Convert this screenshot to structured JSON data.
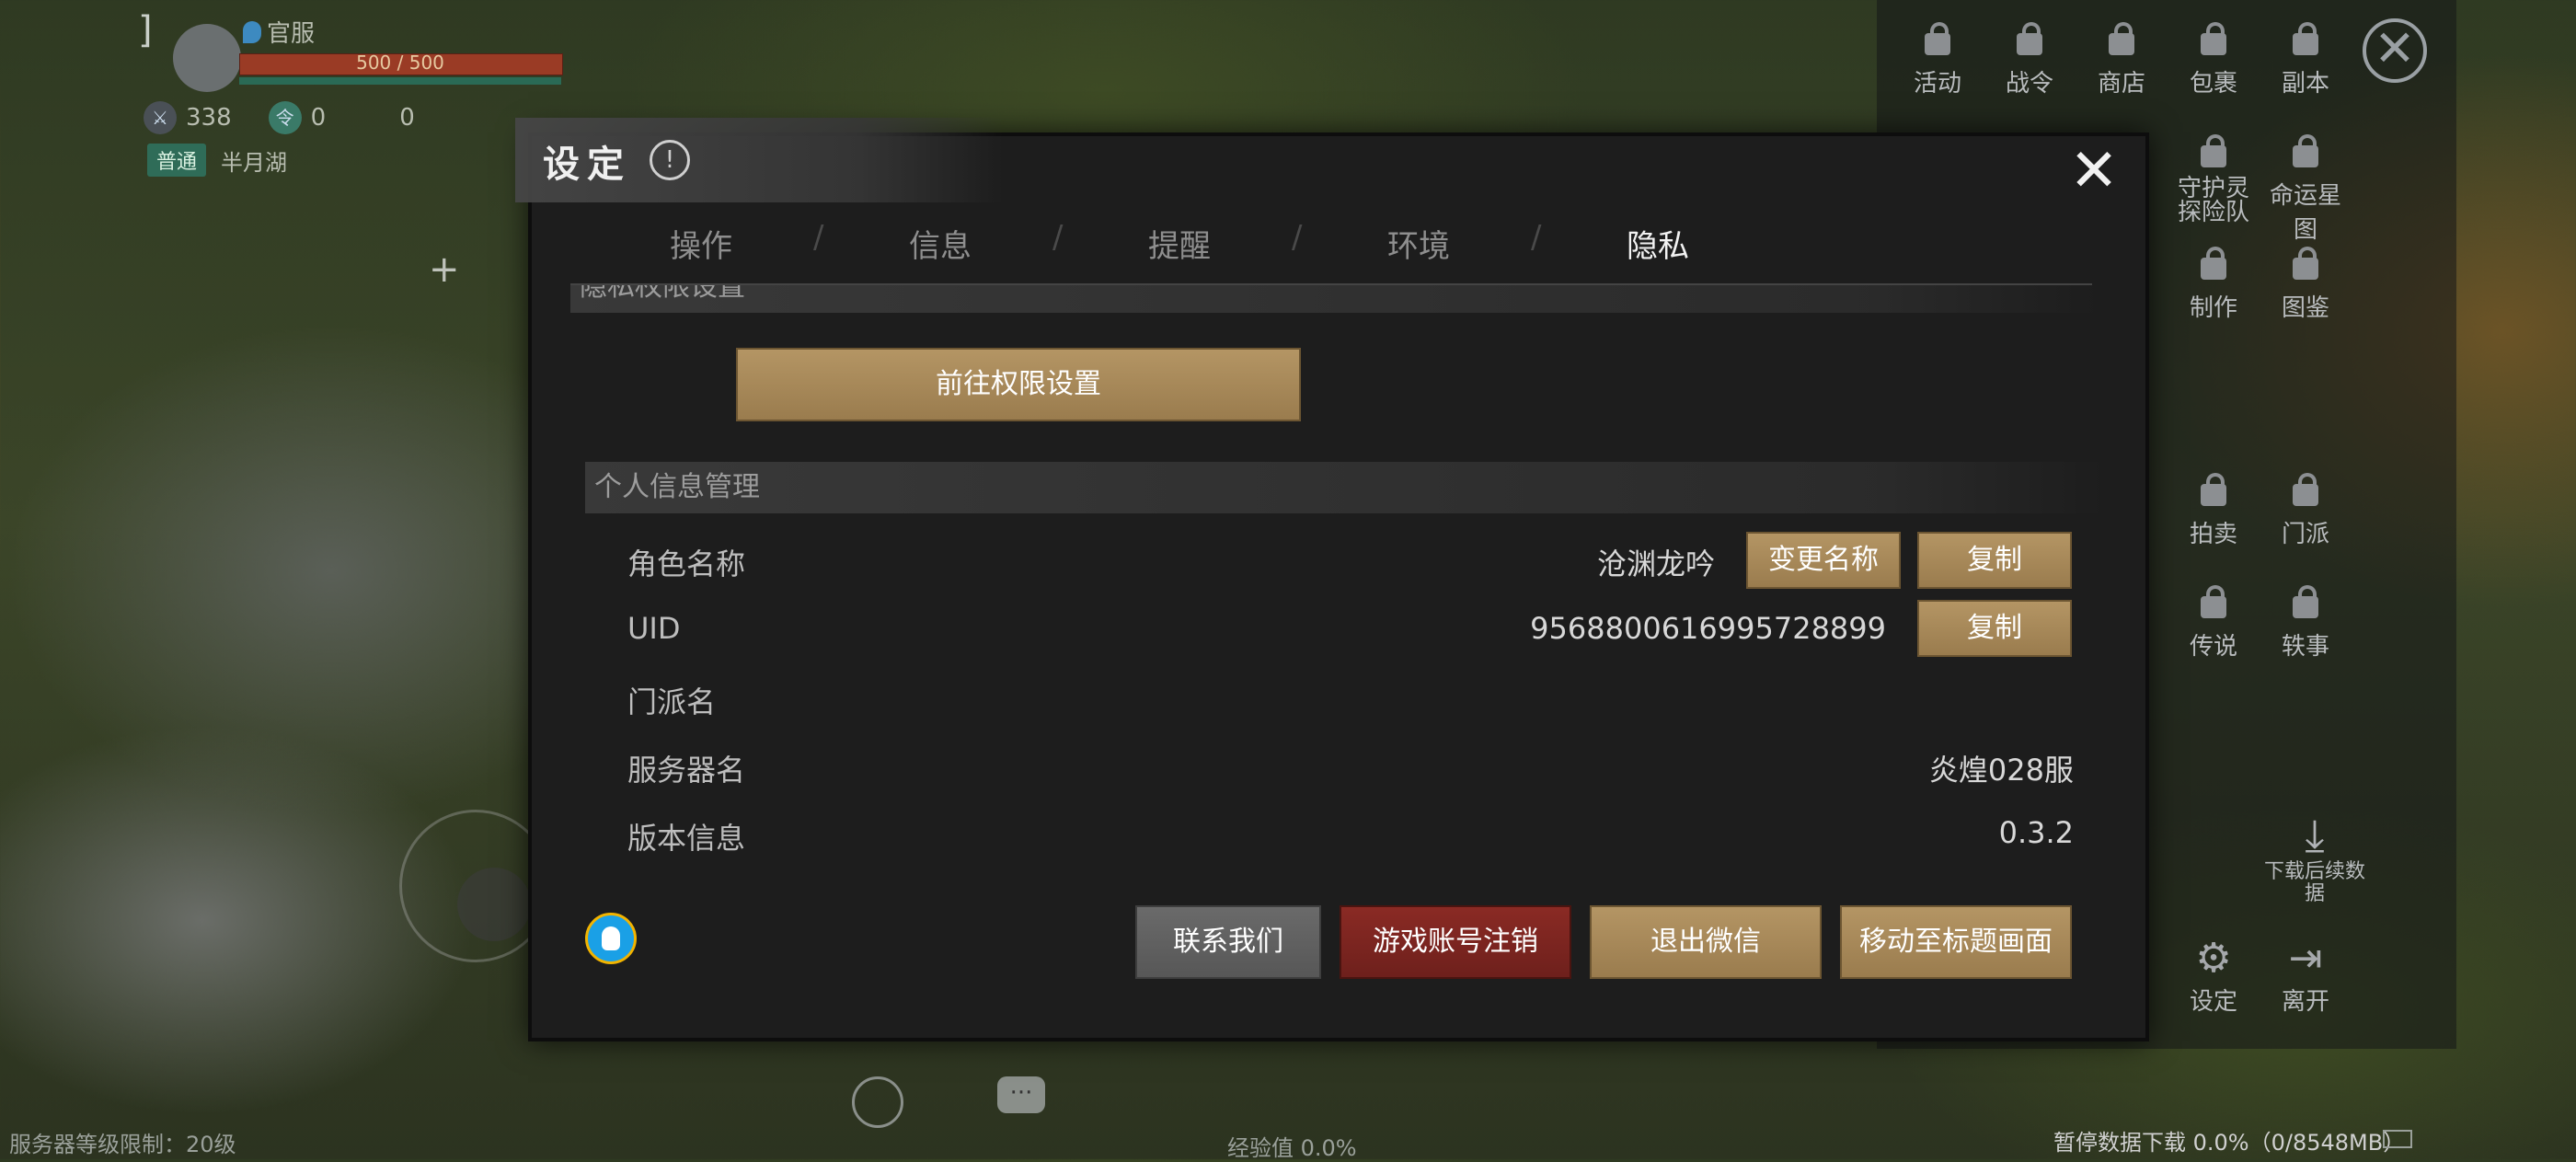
{
  "hud": {
    "server_tag": "官服",
    "hp": "500 / 500",
    "stat_left": "338",
    "stat_mid": "0",
    "stat_right": "0",
    "mode_badge": "普通",
    "location": "半月湖",
    "level_limit": "服务器等级限制：20级",
    "exp": "经验值 0.0%",
    "download_status": "暂停数据下载 0.0%（0/8548MB）"
  },
  "right_menu": {
    "row1": [
      "活动",
      "战令",
      "商店",
      "包裹",
      "副本"
    ],
    "row2": [
      "守护灵探险队",
      "命运星图"
    ],
    "row3": [
      "制作",
      "图鉴"
    ],
    "row4": [
      "拍卖",
      "门派"
    ],
    "row5": [
      "传说",
      "轶事"
    ],
    "download_more": "下载后续数据",
    "settings": "设定",
    "leave": "离开"
  },
  "dialog": {
    "title": "设定",
    "tabs": [
      "操作",
      "信息",
      "提醒",
      "环境",
      "隐私"
    ],
    "active_tab": "隐私",
    "section_permissions": "隐私权限设置",
    "goto_permissions_button": "前往权限设置",
    "section_personal": "个人信息管理",
    "rows": {
      "role_name_label": "角色名称",
      "role_name_value": "沧渊龙吟",
      "rename_button": "变更名称",
      "copy_button": "复制",
      "uid_label": "UID",
      "uid_value": "9568800616995728899",
      "sect_label": "门派名",
      "server_label": "服务器名",
      "server_value": "炎煌028服",
      "version_label": "版本信息",
      "version_value": "0.3.2"
    },
    "footer_buttons": {
      "contact": "联系我们",
      "delete_account": "游戏账号注销",
      "logout_wechat": "退出微信",
      "to_title": "移动至标题画面"
    },
    "colors": {
      "gold": "#b49564",
      "red": "#8a2a24",
      "gray": "#6a6a6a"
    }
  }
}
